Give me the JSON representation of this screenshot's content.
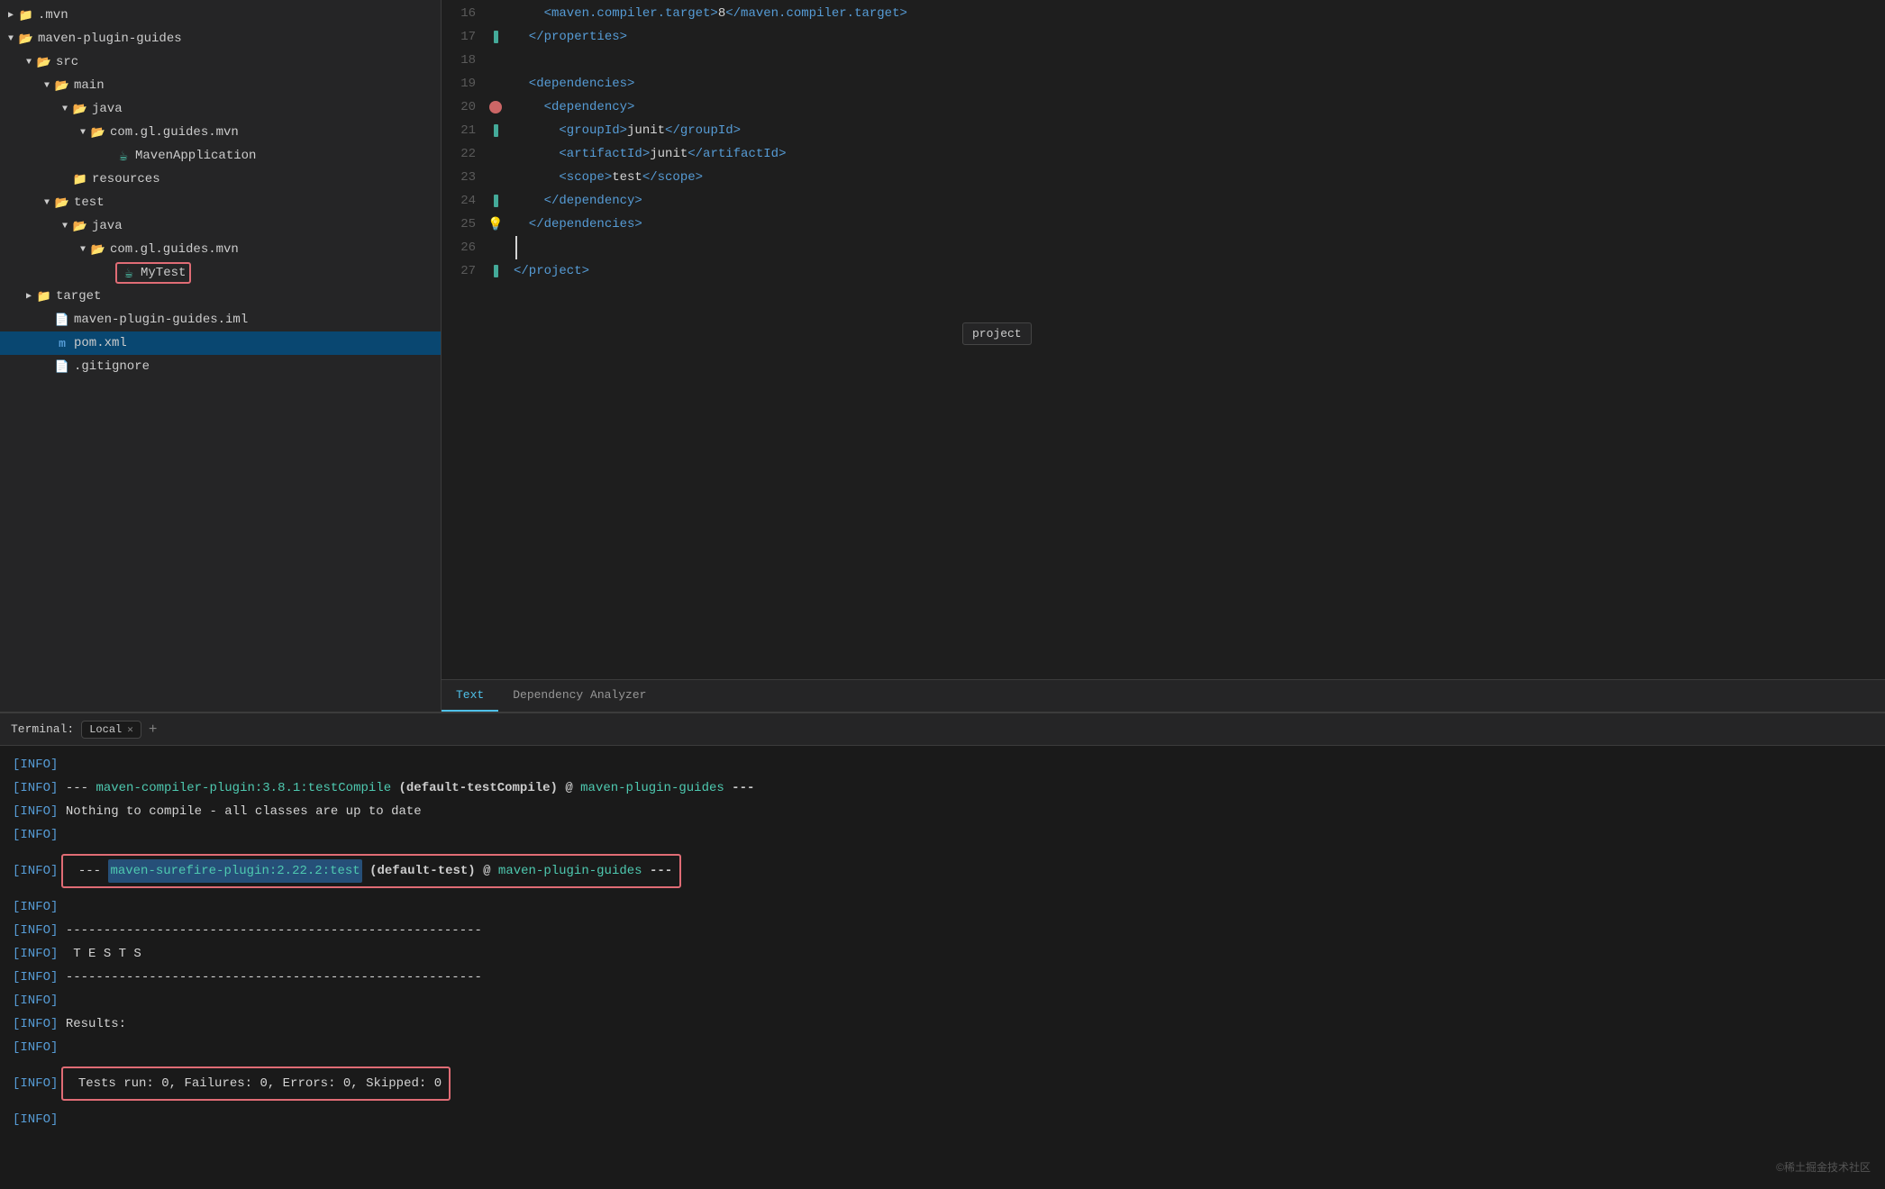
{
  "sidebar": {
    "items": [
      {
        "id": "mvn",
        "label": ".mvn",
        "indent": 0,
        "type": "folder",
        "state": "collapsed",
        "arrow": "▶"
      },
      {
        "id": "maven-plugin-guides",
        "label": "maven-plugin-guides",
        "indent": 0,
        "type": "folder-open",
        "state": "expanded",
        "arrow": "▼"
      },
      {
        "id": "src",
        "label": "src",
        "indent": 1,
        "type": "folder-open",
        "state": "expanded",
        "arrow": "▼"
      },
      {
        "id": "main",
        "label": "main",
        "indent": 2,
        "type": "folder-open",
        "state": "expanded",
        "arrow": "▼"
      },
      {
        "id": "java",
        "label": "java",
        "indent": 3,
        "type": "folder-open",
        "state": "expanded",
        "arrow": "▼"
      },
      {
        "id": "com.gl.guides.mvn",
        "label": "com.gl.guides.mvn",
        "indent": 4,
        "type": "folder-open",
        "state": "expanded",
        "arrow": "▼"
      },
      {
        "id": "MavenApplication",
        "label": "MavenApplication",
        "indent": 5,
        "type": "java",
        "state": "leaf",
        "arrow": ""
      },
      {
        "id": "resources",
        "label": "resources",
        "indent": 3,
        "type": "folder",
        "state": "collapsed",
        "arrow": ""
      },
      {
        "id": "test",
        "label": "test",
        "indent": 2,
        "type": "folder-open",
        "state": "expanded",
        "arrow": "▼"
      },
      {
        "id": "java-test",
        "label": "java",
        "indent": 3,
        "type": "folder-open",
        "state": "expanded",
        "arrow": "▼"
      },
      {
        "id": "com.gl.guides.mvn2",
        "label": "com.gl.guides.mvn",
        "indent": 4,
        "type": "folder-open",
        "state": "expanded",
        "arrow": "▼"
      },
      {
        "id": "MyTest",
        "label": "MyTest",
        "indent": 5,
        "type": "java",
        "state": "leaf",
        "arrow": "",
        "highlighted": true
      },
      {
        "id": "target",
        "label": "target",
        "indent": 1,
        "type": "folder",
        "state": "collapsed",
        "arrow": "▶"
      },
      {
        "id": "maven-plugin-guides.iml",
        "label": "maven-plugin-guides.iml",
        "indent": 1,
        "type": "iml",
        "state": "leaf",
        "arrow": ""
      },
      {
        "id": "pom.xml",
        "label": "pom.xml",
        "indent": 1,
        "type": "xml",
        "state": "leaf",
        "arrow": "",
        "selected": true
      },
      {
        "id": ".gitignore",
        "label": ".gitignore",
        "indent": 1,
        "type": "gitignore",
        "state": "leaf",
        "arrow": ""
      }
    ]
  },
  "editor": {
    "lines": [
      {
        "num": 16,
        "gutter": "",
        "content": "    <maven.compiler.target>8</maven.compiler.target>"
      },
      {
        "num": 17,
        "gutter": "bookmark",
        "content": "  </properties>"
      },
      {
        "num": 18,
        "gutter": "",
        "content": ""
      },
      {
        "num": 19,
        "gutter": "",
        "content": "  <dependencies>"
      },
      {
        "num": 20,
        "gutter": "breakpoint",
        "content": "    <dependency>"
      },
      {
        "num": 21,
        "gutter": "",
        "content": "      <groupId>junit</groupId>"
      },
      {
        "num": 22,
        "gutter": "",
        "content": "      <artifactId>junit</artifactId>"
      },
      {
        "num": 23,
        "gutter": "",
        "content": "      <scope>test</scope>"
      },
      {
        "num": 24,
        "gutter": "bookmark",
        "content": "    </dependency>"
      },
      {
        "num": 25,
        "gutter": "lightbulb",
        "content": "  </dependencies>"
      },
      {
        "num": 26,
        "gutter": "",
        "content": ""
      },
      {
        "num": 27,
        "gutter": "bookmark2",
        "content": "</project>"
      }
    ],
    "tooltip": "project"
  },
  "tabs": [
    {
      "label": "Text",
      "active": true
    },
    {
      "label": "Dependency Analyzer",
      "active": false
    }
  ],
  "terminal": {
    "title": "Terminal:",
    "tabs": [
      {
        "label": "Local",
        "active": true
      }
    ],
    "add_label": "+",
    "lines": [
      {
        "text": "[INFO]",
        "type": "info-only"
      },
      {
        "text": "[INFO] --- maven-compiler-plugin:3.8.1:testCompile (default-testCompile) @ maven-plugin-guides ---",
        "type": "compiler-line"
      },
      {
        "text": "[INFO] Nothing to compile - all classes are up to date",
        "type": "plain"
      },
      {
        "text": "[INFO]",
        "type": "info-only"
      },
      {
        "text": "[INFO] --- maven-surefire-plugin:2.22.2:test (default-test) @ maven-plugin-guides ---",
        "type": "surefire-line",
        "redbox": true
      },
      {
        "text": "[INFO]",
        "type": "info-only"
      },
      {
        "text": "[INFO] -------------------------------------------------------",
        "type": "plain"
      },
      {
        "text": "[INFO]  T E S T S",
        "type": "plain"
      },
      {
        "text": "[INFO] -------------------------------------------------------",
        "type": "plain"
      },
      {
        "text": "[INFO]",
        "type": "info-only"
      },
      {
        "text": "[INFO] Results:",
        "type": "plain"
      },
      {
        "text": "[INFO]",
        "type": "info-only"
      },
      {
        "text": "[INFO] Tests run: 0, Failures: 0, Errors: 0, Skipped: 0",
        "type": "tests-result",
        "redbox": true
      },
      {
        "text": "[INFO]",
        "type": "info-only"
      }
    ]
  },
  "watermark": "©稀土掘金技术社区"
}
